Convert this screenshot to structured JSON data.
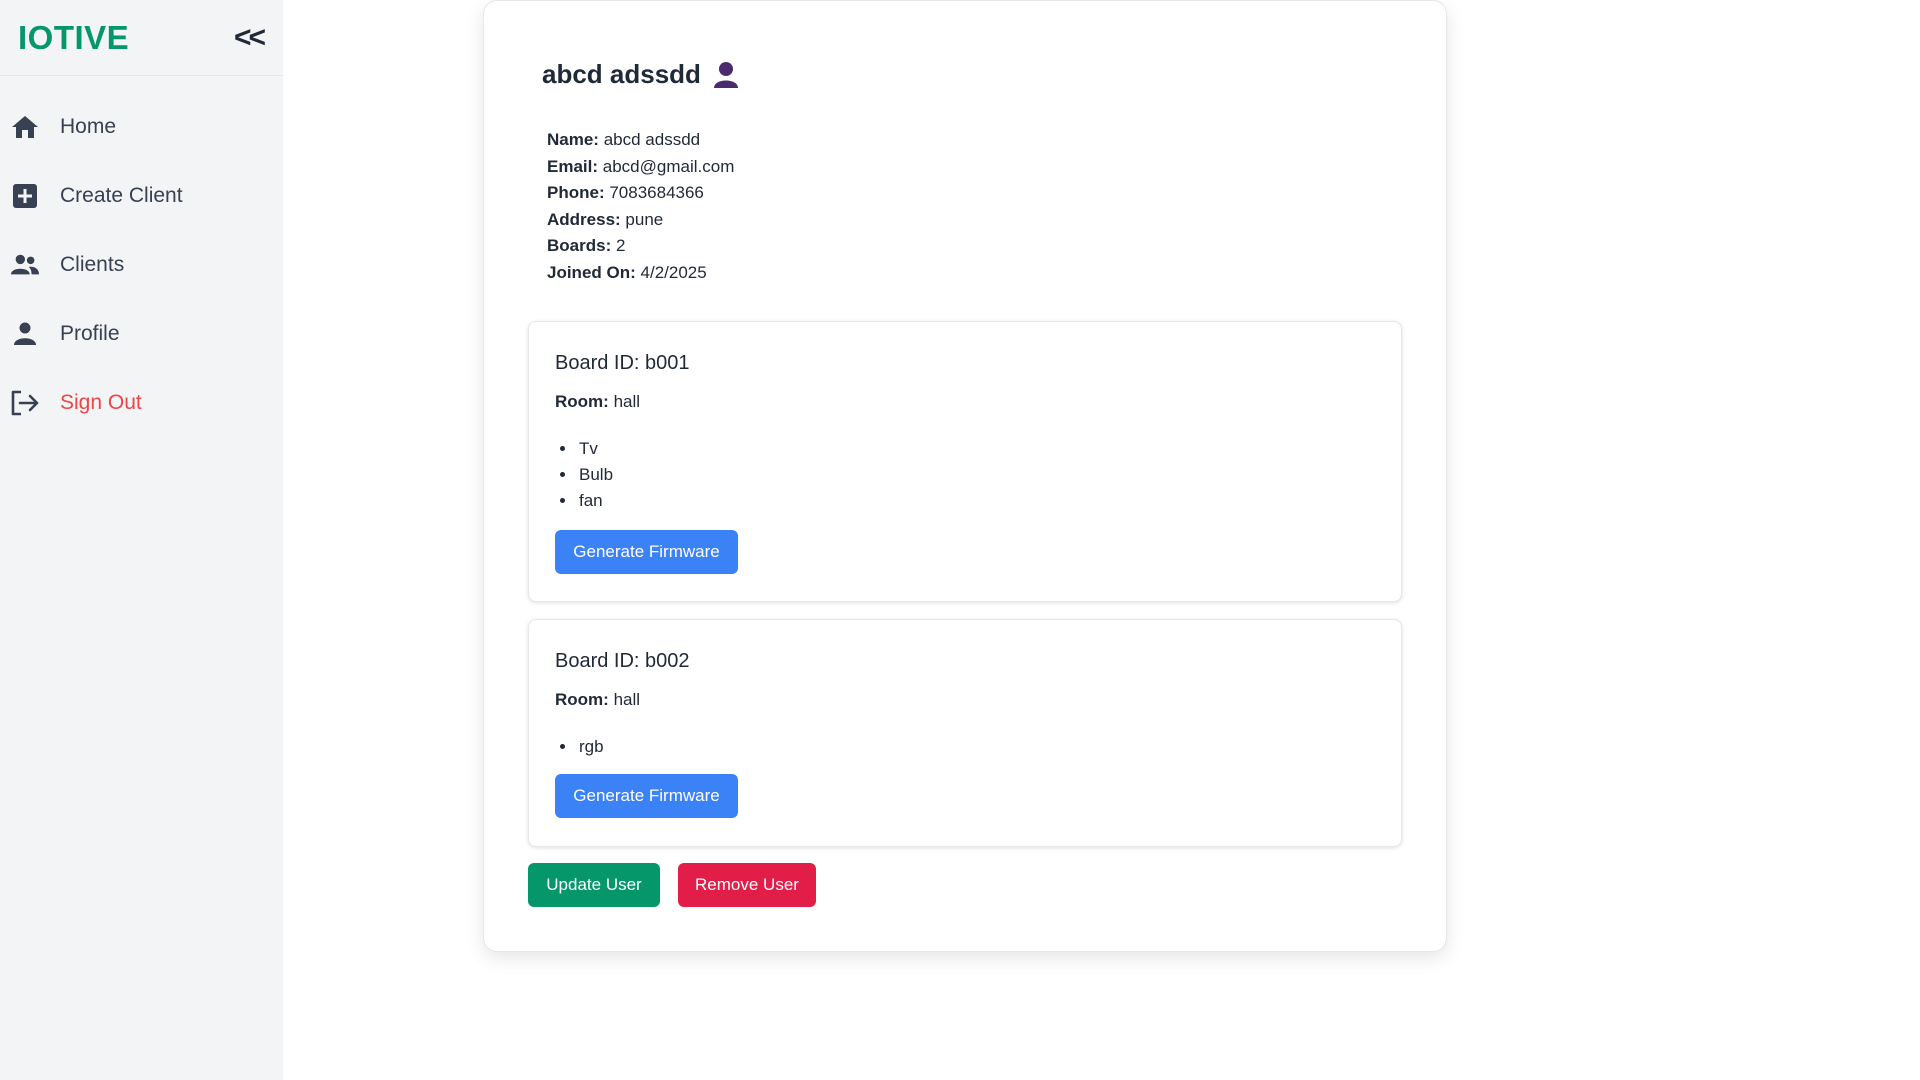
{
  "sidebar": {
    "brand": "IOTIVE",
    "collapse_label": "<<",
    "items": [
      {
        "label": "Home",
        "icon": "home-icon"
      },
      {
        "label": "Create Client",
        "icon": "plus-square-icon"
      },
      {
        "label": "Clients",
        "icon": "users-icon"
      },
      {
        "label": "Profile",
        "icon": "user-icon"
      },
      {
        "label": "Sign Out",
        "icon": "sign-out-icon"
      }
    ]
  },
  "user": {
    "display_name": "abcd adssdd",
    "fields": {
      "name_label": "Name:",
      "name": "abcd adssdd",
      "email_label": "Email:",
      "email": "abcd@gmail.com",
      "phone_label": "Phone:",
      "phone": "7083684366",
      "address_label": "Address:",
      "address": "pune",
      "boards_label": "Boards:",
      "boards": "2",
      "joined_label": "Joined On:",
      "joined": "4/2/2025"
    }
  },
  "boards": [
    {
      "id_label": "Board ID: ",
      "id": "b001",
      "room_label": "Room:",
      "room": "hall",
      "appliances": [
        "Tv",
        "Bulb",
        "fan"
      ],
      "button_label": "Generate Firmware"
    },
    {
      "id_label": "Board ID: ",
      "id": "b002",
      "room_label": "Room:",
      "room": "hall",
      "appliances": [
        "rgb"
      ],
      "button_label": "Generate Firmware"
    }
  ],
  "actions": {
    "update_label": "Update User",
    "remove_label": "Remove User"
  },
  "colors": {
    "brand": "#059669",
    "primary": "#3b82f6",
    "success": "#059669",
    "danger": "#e11d48",
    "signout": "#ef4444",
    "user_icon": "#4c2a6e"
  }
}
